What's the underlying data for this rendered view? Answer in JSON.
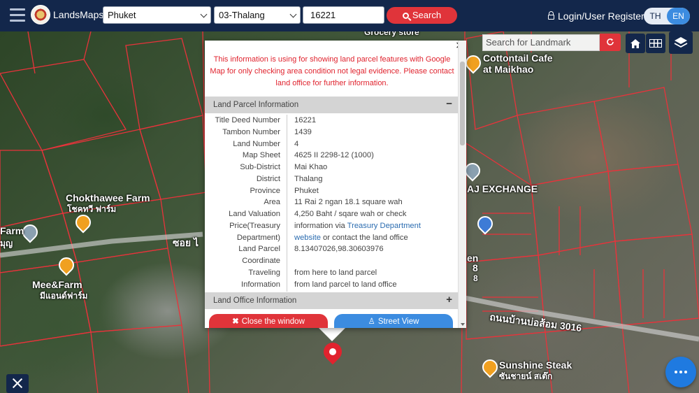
{
  "topbar": {
    "brand": "LandsMaps",
    "province_select": "Phuket",
    "district_select": "03-Thalang",
    "deed_number_input": "16221",
    "search_label": "Search",
    "login_label": "Login/User Register",
    "lang_th": "TH",
    "lang_en": "EN",
    "lang_selected": "EN"
  },
  "map_controls": {
    "landmark_placeholder": "Search for Landmark",
    "refresh_icon": "refresh-icon",
    "home_icon": "home-icon",
    "grid_icon": "grid-icon",
    "layers_icon": "layers-icon"
  },
  "map_labels": {
    "chokthawee": "Chokthawee Farm",
    "chokthawee_th": "โชคทวี ฟาร์ม",
    "farm": "Farm",
    "farm_th": "มุญ",
    "mee_farm": "Mee&Farm",
    "mee_farm_th": "มีแอนด์ฟาร์ม",
    "soi": "ซอย ไ",
    "cottontail": "Cottontail Cafe",
    "cottontail_line2": "at Maikhao",
    "exchange": "AJ EXCHANGE",
    "road_th": "ถนนบ้านบ่อส้อม 3016",
    "sunshine": "Sunshine Steak",
    "sunshine_th": "ซันชายน์ สเต๊ก",
    "num_8a": "8",
    "num_8b": "8",
    "en": "en",
    "grocery": "Grocery store"
  },
  "popup": {
    "close_symbol": "×",
    "notice": "This information is using for showing land parcel features with Google Map for only checking area condition not legal evidence. Please contact land office for further information.",
    "parcel_section_title": "Land Parcel Information",
    "parcel_section_toggle": "−",
    "office_section_title": "Land Office Information",
    "office_section_toggle": "+",
    "fields": [
      {
        "key": "Title Deed Number",
        "value": "16221"
      },
      {
        "key": "Tambon Number",
        "value": "1439"
      },
      {
        "key": "Land Number",
        "value": "4"
      },
      {
        "key": "Map Sheet",
        "value": "4625 II 2298-12 (1000)"
      },
      {
        "key": "Sub-District",
        "value": "Mai Khao"
      },
      {
        "key": "District",
        "value": "Thalang"
      },
      {
        "key": "Province",
        "value": "Phuket"
      },
      {
        "key": "Area",
        "value": "11 Rai 2 ngan 18.1 square wah"
      },
      {
        "key": "Land Valuation",
        "value": "4,250 Baht / sqare wah or check"
      }
    ],
    "price_key_1": "Price(Treasury",
    "price_key_2": "Department)",
    "price_val_1a": "information via ",
    "price_val_1b": "Treasury Department",
    "price_val_2a": "website",
    "price_val_2b": " or contact the land office",
    "coord_key_1": "Land Parcel",
    "coord_key_2": "Coordinate",
    "coord_value": "8.13407026,98.30603976",
    "travel_key_1": "Traveling",
    "travel_key_2": "Information",
    "travel_link_1": "from here to land parcel",
    "travel_link_2": "from land parcel to land office",
    "close_window_label": "Close the window",
    "street_view_label": "Street View"
  }
}
